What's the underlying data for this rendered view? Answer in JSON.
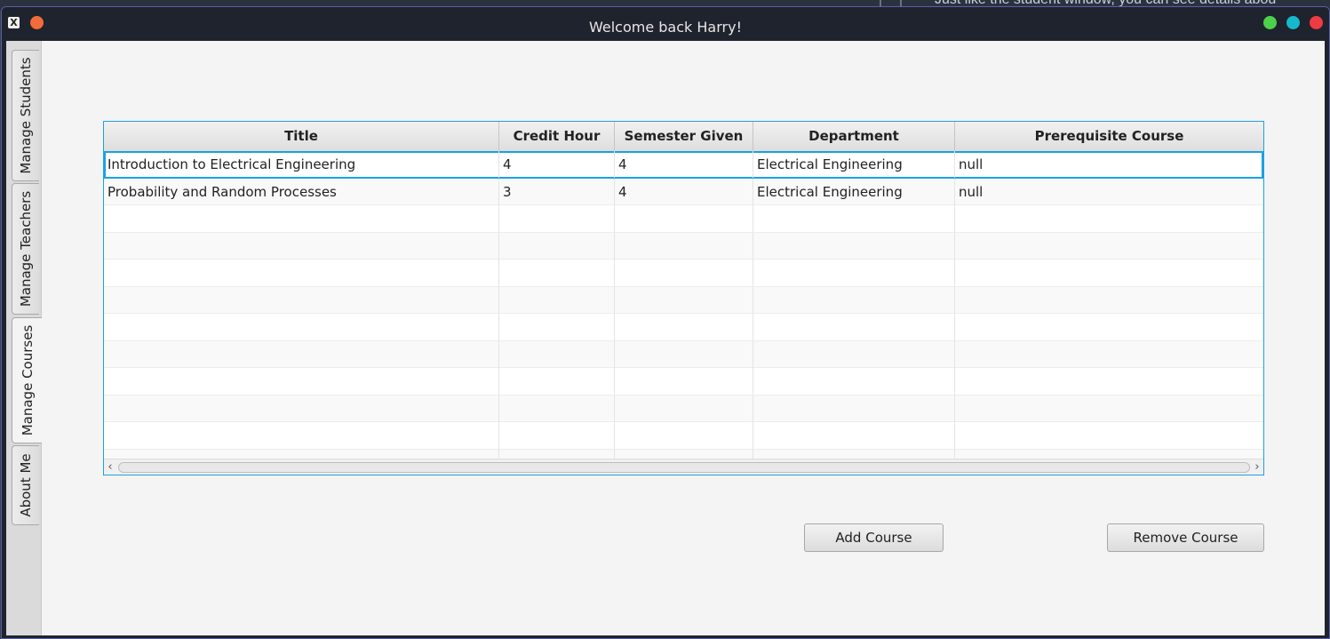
{
  "background_window": {
    "text": "Just like the student window, you can see details abou"
  },
  "window": {
    "title": "Welcome back Harry!"
  },
  "tabs": [
    {
      "label": "Manage Students"
    },
    {
      "label": "Manage Teachers"
    },
    {
      "label": "Manage Courses",
      "active": true
    },
    {
      "label": "About Me"
    }
  ],
  "table": {
    "columns": [
      "Title",
      "Credit Hour",
      "Semester Given",
      "Department",
      "Prerequisite Course"
    ],
    "rows": [
      [
        "Introduction to Electrical Engineering",
        "4",
        "4",
        "Electrical Engineering",
        "null"
      ],
      [
        "Probability and Random Processes",
        "3",
        "4",
        "Electrical Engineering",
        "null"
      ]
    ],
    "selected_row": 0
  },
  "buttons": {
    "add": "Add Course",
    "remove": "Remove Course"
  },
  "colors": {
    "selection": "#1ba1e2",
    "titlebar": "#1f232d"
  }
}
